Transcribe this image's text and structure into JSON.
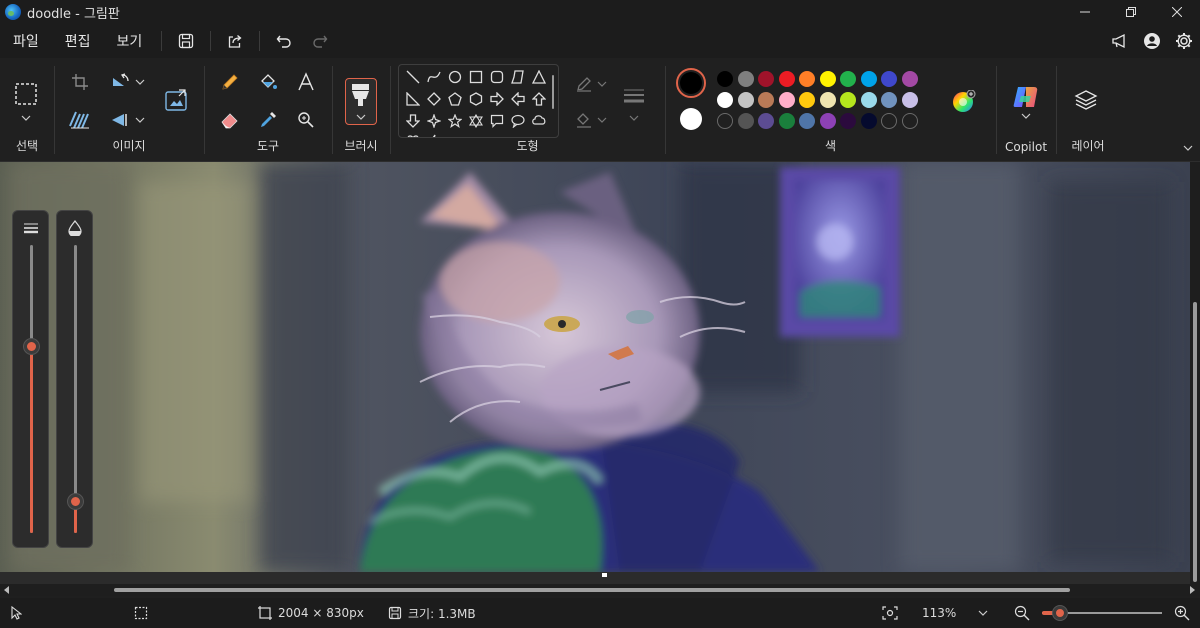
{
  "window": {
    "title": "doodle - 그림판"
  },
  "menu": {
    "file": "파일",
    "edit": "편집",
    "view": "보기"
  },
  "ribbon": {
    "select": {
      "label": "선택"
    },
    "image": {
      "label": "이미지"
    },
    "tools": {
      "label": "도구"
    },
    "brush": {
      "label": "브러시"
    },
    "shapes": {
      "label": "도형"
    },
    "colors": {
      "label": "색",
      "primary": "#000000",
      "secondary": "#ffffff",
      "palette": [
        [
          "#000000",
          "#7f7f7f",
          "#a0132a",
          "#ec1c24",
          "#ff7f27",
          "#fff200",
          "#22b14c",
          "#00a2e8",
          "#3f48cc",
          "#a349a4"
        ],
        [
          "#ffffff",
          "#c3c3c3",
          "#b97a57",
          "#ffaec9",
          "#ffc90e",
          "#efe4b0",
          "#b5e61d",
          "#99d9ea",
          "#7092be",
          "#c8bfe7"
        ],
        [
          "",
          "#545454",
          "#5c4c92",
          "#1a7f3c",
          "#4f75a8",
          "#8d41b5",
          "#2b0a3d",
          "#050a2e",
          "",
          ""
        ]
      ]
    },
    "copilot": {
      "label": "Copilot"
    },
    "layers": {
      "label": "레이어"
    }
  },
  "status": {
    "dimensions": "2004 × 830px",
    "size": "크기: 1.3MB",
    "zoom": "113%"
  },
  "sliders": {
    "brush_size_level": 0.65,
    "opacity_level": 0.11
  },
  "zoom_level": 0.15
}
